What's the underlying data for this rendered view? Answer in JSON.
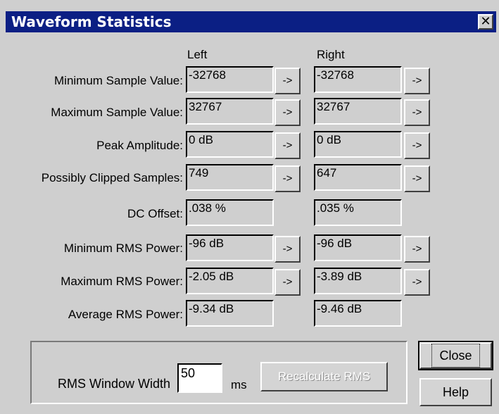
{
  "window": {
    "title": "Waveform Statistics",
    "close_glyph": "✕"
  },
  "columns": {
    "left": "Left",
    "right": "Right"
  },
  "rows": [
    {
      "label": "Minimum Sample Value:",
      "left": "-32768",
      "right": "-32768",
      "goto": "->"
    },
    {
      "label": "Maximum Sample Value:",
      "left": "32767",
      "right": "32767",
      "goto": "->"
    },
    {
      "label": "Peak Amplitude:",
      "left": "0 dB",
      "right": "0 dB",
      "goto": "->"
    },
    {
      "label": "Possibly Clipped Samples:",
      "left": "749",
      "right": "647",
      "goto": "->"
    },
    {
      "label": "DC Offset:",
      "left": ".038 %",
      "right": ".035 %",
      "goto": ""
    },
    {
      "label": "Minimum RMS Power:",
      "left": "-96 dB",
      "right": "-96 dB",
      "goto": "->"
    },
    {
      "label": "Maximum RMS Power:",
      "left": "-2.05 dB",
      "right": "-3.89 dB",
      "goto": "->"
    },
    {
      "label": "Average RMS Power:",
      "left": "-9.34 dB",
      "right": "-9.46 dB",
      "goto": ""
    }
  ],
  "rms": {
    "label": "RMS Window Width",
    "value": "50",
    "unit": "ms",
    "recalculate_label": "Recalculate RMS"
  },
  "buttons": {
    "close": "Close",
    "help": "Help"
  },
  "colors": {
    "titlebar": "#0b1f84",
    "face": "#cfcfcf"
  }
}
